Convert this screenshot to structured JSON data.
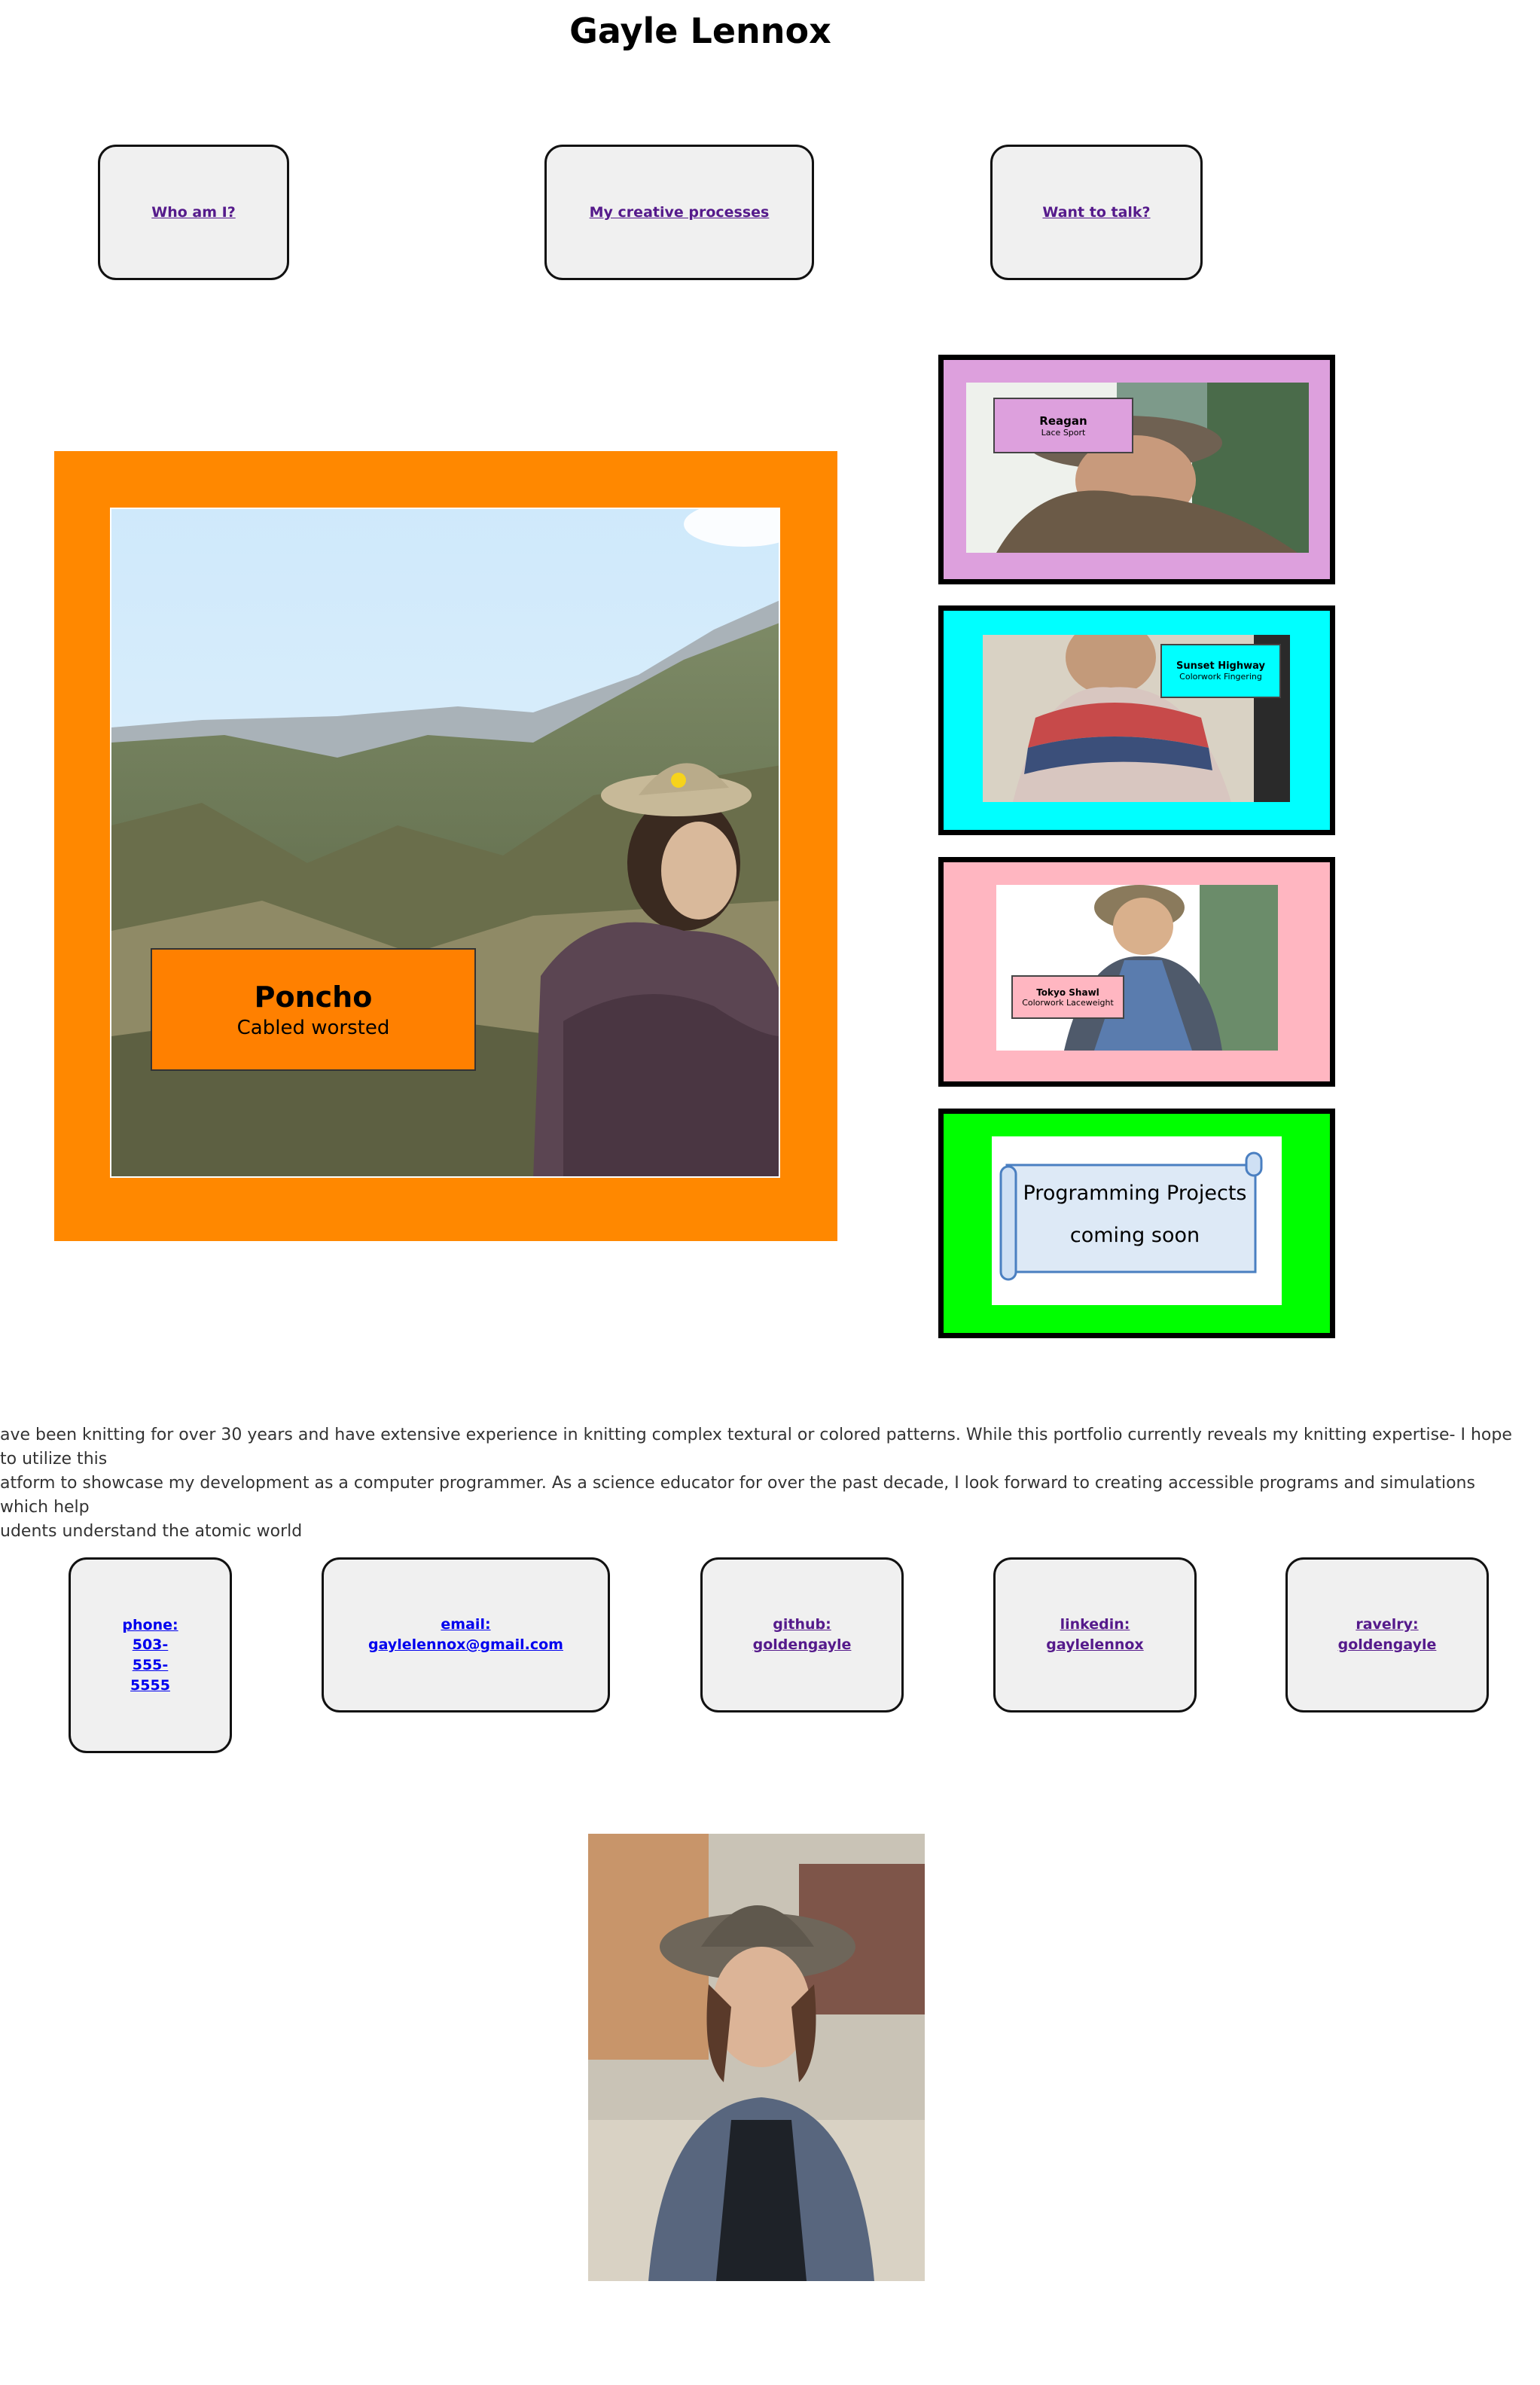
{
  "header": {
    "title": "Gayle Lennox"
  },
  "nav": [
    {
      "label": "Who am I?"
    },
    {
      "label": "My creative processes"
    },
    {
      "label": "Want to talk?"
    }
  ],
  "hero": {
    "title": "Poncho",
    "subtitle": "Cabled worsted",
    "frame_color": "#ff8800"
  },
  "projects": [
    {
      "title": "Reagan",
      "subtitle": "Lace Sport",
      "frame_color": "#dda0dd"
    },
    {
      "title": "Sunset Highway",
      "subtitle": "Colorwork Fingering",
      "frame_color": "#00ffff"
    },
    {
      "title": "Tokyo Shawl",
      "subtitle": "Colorwork Laceweight",
      "frame_color": "#ffb6c1"
    },
    {
      "title": "Programming Projects",
      "subtitle": "coming soon",
      "frame_color": "#00ff00"
    }
  ],
  "bio": "ave been knitting for over 30 years and have extensive experience in knitting complex textural or colored patterns. While this portfolio currently reveals my knitting expertise- I hope to utilize this\natform to showcase my development as a computer programmer. As a science educator for over the past decade, I look forward to creating accessible programs and simulations which help\nudents understand the atomic world",
  "contacts": {
    "phone": {
      "label": "phone:",
      "value1": "503-",
      "value2": "555-",
      "value3": "5555"
    },
    "email": {
      "label": "email:",
      "value": "gaylelennox@gmail.com"
    },
    "github": {
      "label": "github:",
      "value": "goldengayle"
    },
    "linkedin": {
      "label": "linkedin:",
      "value": "gaylelennox"
    },
    "ravelry": {
      "label": "ravelry:",
      "value": "goldengayle"
    }
  }
}
